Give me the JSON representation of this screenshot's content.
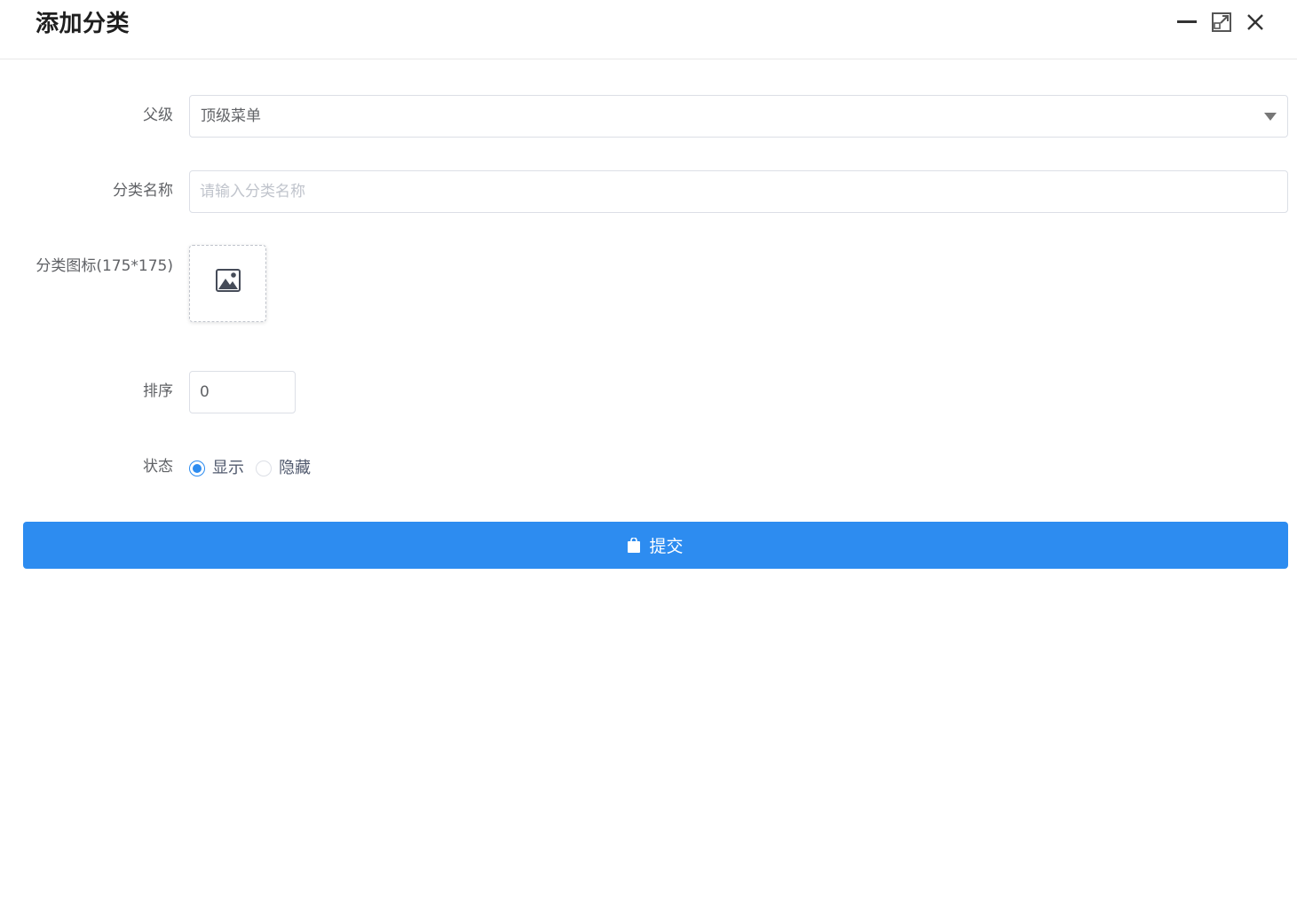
{
  "dialog": {
    "title": "添加分类"
  },
  "form": {
    "parent": {
      "label": "父级",
      "value": "顶级菜单"
    },
    "name": {
      "label": "分类名称",
      "placeholder": "请输入分类名称",
      "value": ""
    },
    "icon": {
      "label": "分类图标(175*175)"
    },
    "sort": {
      "label": "排序",
      "value": "0"
    },
    "status": {
      "label": "状态",
      "options": [
        "显示",
        "隐藏"
      ],
      "selected": "显示"
    },
    "submit_label": "提交"
  },
  "colors": {
    "primary": "#2d8cf0",
    "border": "#dcdfe6",
    "placeholder": "#c0c4cc"
  }
}
